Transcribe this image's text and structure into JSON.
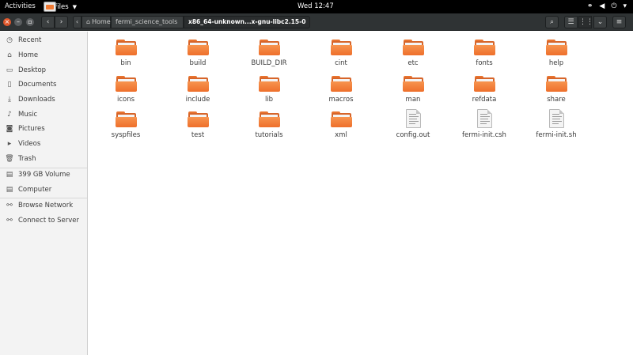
{
  "topbar": {
    "activities": "Activities",
    "app_name": "Files",
    "clock": "Wed 12:47",
    "tray_icons": [
      "network-icon",
      "volume-icon",
      "power-icon",
      "chevron-down-icon"
    ]
  },
  "headerbar": {
    "window_controls": [
      "close-icon",
      "minimize-icon",
      "maximize-icon"
    ],
    "breadcrumbs": {
      "root": "‹",
      "home": "Home",
      "fermi": "fermi_science_tools",
      "current": "x86_64-unknown...x-gnu-libc2.15-0"
    },
    "tools": [
      "search-icon",
      "list-view-icon",
      "grid-view-icon",
      "sort-menu-icon",
      "hamburger-menu-icon"
    ]
  },
  "sidebar": {
    "places": [
      {
        "label": "Recent",
        "icon": "clock-icon"
      },
      {
        "label": "Home",
        "icon": "home-icon"
      },
      {
        "label": "Desktop",
        "icon": "desktop-icon"
      },
      {
        "label": "Documents",
        "icon": "document-icon"
      },
      {
        "label": "Downloads",
        "icon": "download-icon"
      },
      {
        "label": "Music",
        "icon": "music-icon"
      },
      {
        "label": "Pictures",
        "icon": "camera-icon"
      },
      {
        "label": "Videos",
        "icon": "video-icon"
      },
      {
        "label": "Trash",
        "icon": "trash-icon"
      }
    ],
    "devices": [
      {
        "label": "399 GB Volume",
        "icon": "drive-icon"
      },
      {
        "label": "Computer",
        "icon": "computer-icon"
      }
    ],
    "network": [
      {
        "label": "Browse Network",
        "icon": "network-icon"
      },
      {
        "label": "Connect to Server",
        "icon": "server-icon"
      }
    ]
  },
  "files": [
    {
      "name": "bin",
      "kind": "folder"
    },
    {
      "name": "build",
      "kind": "folder"
    },
    {
      "name": "BUILD_DIR",
      "kind": "folder"
    },
    {
      "name": "cint",
      "kind": "folder"
    },
    {
      "name": "etc",
      "kind": "folder"
    },
    {
      "name": "fonts",
      "kind": "folder"
    },
    {
      "name": "help",
      "kind": "folder"
    },
    {
      "name": "icons",
      "kind": "folder"
    },
    {
      "name": "include",
      "kind": "folder"
    },
    {
      "name": "lib",
      "kind": "folder"
    },
    {
      "name": "macros",
      "kind": "folder"
    },
    {
      "name": "man",
      "kind": "folder"
    },
    {
      "name": "refdata",
      "kind": "folder"
    },
    {
      "name": "share",
      "kind": "folder"
    },
    {
      "name": "syspfiles",
      "kind": "folder"
    },
    {
      "name": "test",
      "kind": "folder"
    },
    {
      "name": "tutorials",
      "kind": "folder"
    },
    {
      "name": "xml",
      "kind": "folder"
    },
    {
      "name": "config.out",
      "kind": "document"
    },
    {
      "name": "fermi-init.csh",
      "kind": "document"
    },
    {
      "name": "fermi-init.sh",
      "kind": "document"
    }
  ]
}
